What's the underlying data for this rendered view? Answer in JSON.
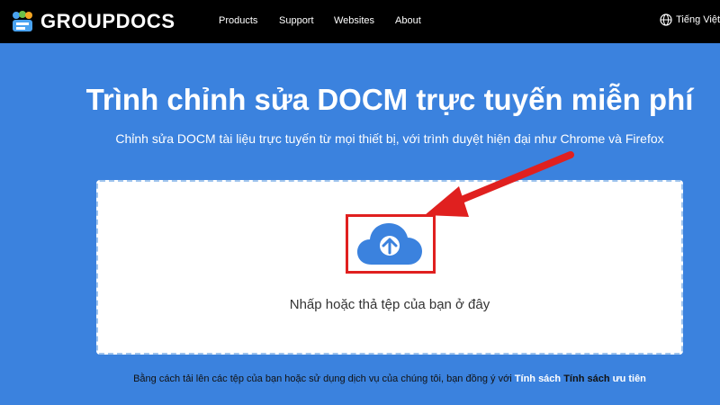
{
  "navbar": {
    "brand": "GROUPDOCS",
    "links": [
      "Products",
      "Support",
      "Websites",
      "About"
    ],
    "language": "Tiếng Việt",
    "language_icon": "globe-icon"
  },
  "hero": {
    "title": "Trình chỉnh sửa DOCM trực tuyến miễn phí",
    "subtitle": "Chỉnh sửa DOCM tài liệu trực tuyến từ mọi thiết bị, với trình duyệt hiện đại như Chrome và Firefox"
  },
  "upload": {
    "icon": "cloud-upload-icon",
    "prompt": "Nhấp hoặc thả tệp của bạn ở đây"
  },
  "terms": {
    "text": "Bằng cách tải lên các tệp của bạn hoặc sử dụng dịch vụ của chúng tôi, bạn đồng ý với",
    "link1": "Tính sách",
    "link2_a": "Tính sách",
    "link2_b": "ưu tiên"
  },
  "colors": {
    "background": "#3b82de",
    "navbar": "#000000",
    "annotation": "#e0201f",
    "cloud": "#3b82de"
  }
}
